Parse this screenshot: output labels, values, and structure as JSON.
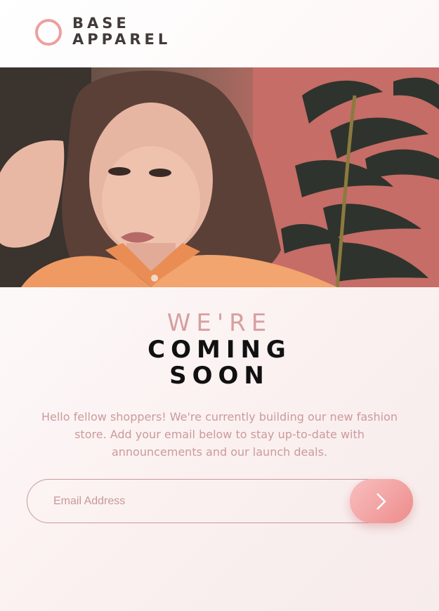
{
  "brand": {
    "line1": "BASE",
    "line2": "APPAREL",
    "accent": "#ef9e9e"
  },
  "hero": {
    "alt": "Woman in orange shirt"
  },
  "headline": {
    "light": "WE'RE",
    "line2": "COMING",
    "line3": "SOON"
  },
  "description": "Hello fellow shoppers! We're currently building our new fashion store. Add your email below to stay up-to-date with announcements and our launch deals.",
  "form": {
    "placeholder": "Email Address",
    "submit_icon": "chevron-right-icon"
  },
  "colors": {
    "text_dark": "#433a3a",
    "soft_red": "#ce9797",
    "gradient_start": "#f8bfbf",
    "gradient_end": "#ee8b8b"
  }
}
